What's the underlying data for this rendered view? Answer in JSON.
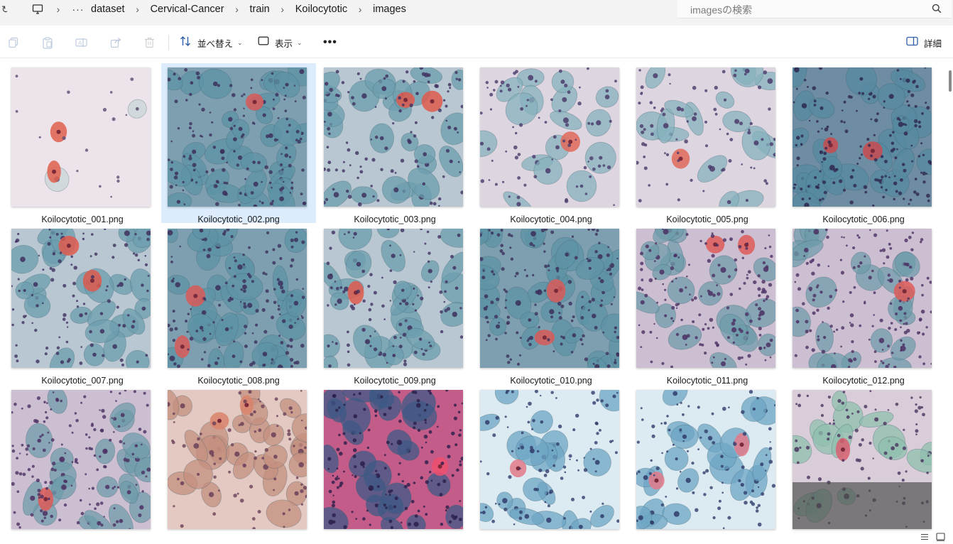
{
  "breadcrumb": {
    "more": "···",
    "items": [
      "dataset",
      "Cervical-Cancer",
      "train",
      "Koilocytotic",
      "images"
    ]
  },
  "search": {
    "placeholder": "imagesの検索"
  },
  "toolbar": {
    "sort_label": "並べ替え",
    "view_label": "表示",
    "more": "•••",
    "details_label": "詳細"
  },
  "icons": {
    "pc": "monitor-icon",
    "search": "search-icon",
    "copy": "copy-icon",
    "paste": "paste-icon",
    "rename": "rename-icon",
    "share": "share-icon",
    "delete": "trash-icon",
    "sort": "sort-icon",
    "view": "view-icon",
    "details": "details-pane-icon",
    "list_view": "list-view-icon",
    "tile_view": "large-icons-view-icon"
  },
  "colors": {
    "selection": "#dcecfc",
    "papanicolaou_blue": "#5f9aa8",
    "papanicolaou_pink": "#d9b8d0",
    "orangeophilic": "#e05a4a"
  },
  "files": [
    {
      "name": "Koilocytotic_001.png",
      "selected": false,
      "palette": "pale"
    },
    {
      "name": "Koilocytotic_002.png",
      "selected": true,
      "palette": "teal-dense"
    },
    {
      "name": "Koilocytotic_003.png",
      "selected": false,
      "palette": "teal"
    },
    {
      "name": "Koilocytotic_004.png",
      "selected": false,
      "palette": "pale-teal"
    },
    {
      "name": "Koilocytotic_005.png",
      "selected": false,
      "palette": "pale-teal"
    },
    {
      "name": "Koilocytotic_006.png",
      "selected": false,
      "palette": "teal-dark"
    },
    {
      "name": "Koilocytotic_007.png",
      "selected": false,
      "palette": "teal"
    },
    {
      "name": "Koilocytotic_008.png",
      "selected": false,
      "palette": "teal-dense"
    },
    {
      "name": "Koilocytotic_009.png",
      "selected": false,
      "palette": "teal"
    },
    {
      "name": "Koilocytotic_010.png",
      "selected": false,
      "palette": "teal-dense"
    },
    {
      "name": "Koilocytotic_011.png",
      "selected": false,
      "palette": "purple"
    },
    {
      "name": "Koilocytotic_012.png",
      "selected": false,
      "palette": "purple"
    },
    {
      "name": "",
      "selected": false,
      "palette": "purple"
    },
    {
      "name": "",
      "selected": false,
      "palette": "brown"
    },
    {
      "name": "",
      "selected": false,
      "palette": "magenta"
    },
    {
      "name": "",
      "selected": false,
      "palette": "light-blue"
    },
    {
      "name": "",
      "selected": false,
      "palette": "light-blue"
    },
    {
      "name": "",
      "selected": false,
      "palette": "green-grey"
    }
  ]
}
